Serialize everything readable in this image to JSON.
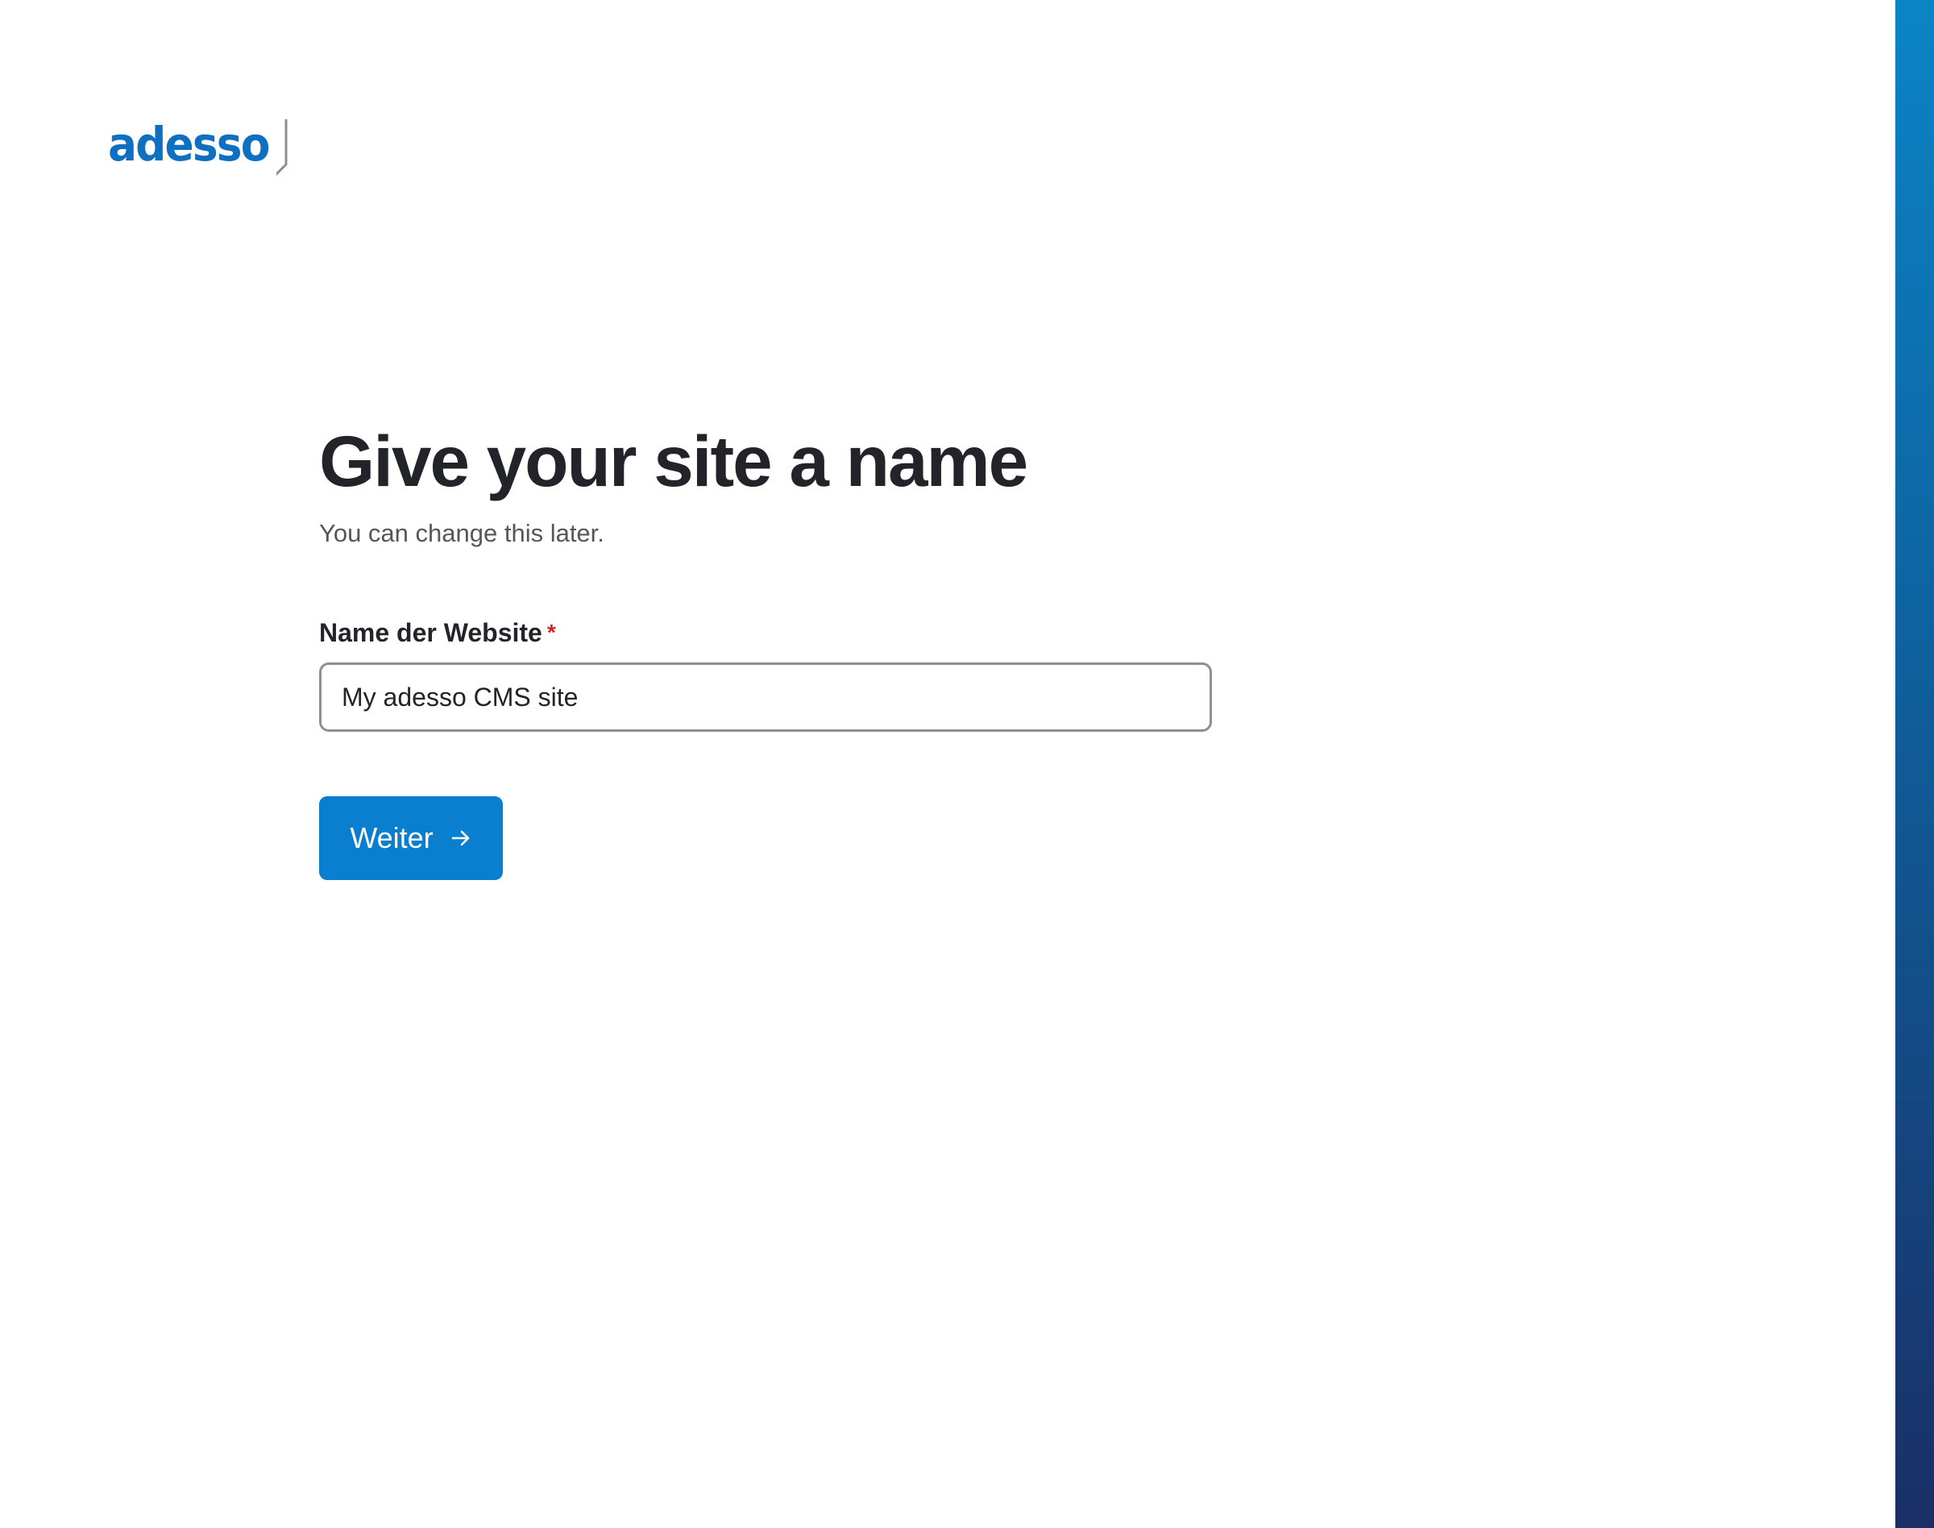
{
  "logo": {
    "text": "adesso",
    "color": "#0f6fc0"
  },
  "page": {
    "title": "Give your site a name",
    "subtitle": "You can change this later."
  },
  "form": {
    "site_name": {
      "label": "Name der Website",
      "required_marker": "*",
      "value": "My adesso CMS site"
    },
    "submit": {
      "label": "Weiter",
      "icon": "arrow-right-icon"
    }
  },
  "colors": {
    "accent": "#0a7fd0",
    "band_top": "#0b84c6",
    "band_bottom": "#1a2f66",
    "required": "#d72222"
  }
}
